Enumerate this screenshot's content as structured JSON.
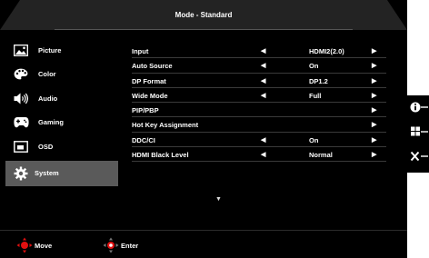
{
  "title": "Mode - Standard",
  "side_menu": [
    {
      "label": "Picture",
      "icon": "picture-icon"
    },
    {
      "label": "Color",
      "icon": "palette-icon"
    },
    {
      "label": "Audio",
      "icon": "speaker-icon"
    },
    {
      "label": "Gaming",
      "icon": "gamepad-icon"
    },
    {
      "label": "OSD",
      "icon": "osd-icon"
    },
    {
      "label": "System",
      "icon": "gear-icon",
      "active": true
    }
  ],
  "settings": [
    {
      "label": "Input",
      "value": "HDMI2(2.0)",
      "left_arrow": true,
      "right_arrow": true
    },
    {
      "label": "Auto Source",
      "value": "On",
      "left_arrow": true,
      "right_arrow": true
    },
    {
      "label": "DP Format",
      "value": "DP1.2",
      "left_arrow": true,
      "right_arrow": true
    },
    {
      "label": "Wide Mode",
      "value": "Full",
      "left_arrow": true,
      "right_arrow": true
    },
    {
      "label": "PIP/PBP",
      "value": "",
      "left_arrow": false,
      "right_arrow": true
    },
    {
      "label": "Hot Key Assignment",
      "value": "",
      "left_arrow": false,
      "right_arrow": true
    },
    {
      "label": "DDC/CI",
      "value": "On",
      "left_arrow": true,
      "right_arrow": true
    },
    {
      "label": "HDMI Black Level",
      "value": "Normal",
      "left_arrow": true,
      "right_arrow": true
    }
  ],
  "bottom": {
    "move_label": "Move",
    "enter_label": "Enter"
  },
  "colors": {
    "background": "#000000",
    "active_item": "#5a5a5a",
    "title_bar": "#232323",
    "nav_red": "#e01010"
  }
}
